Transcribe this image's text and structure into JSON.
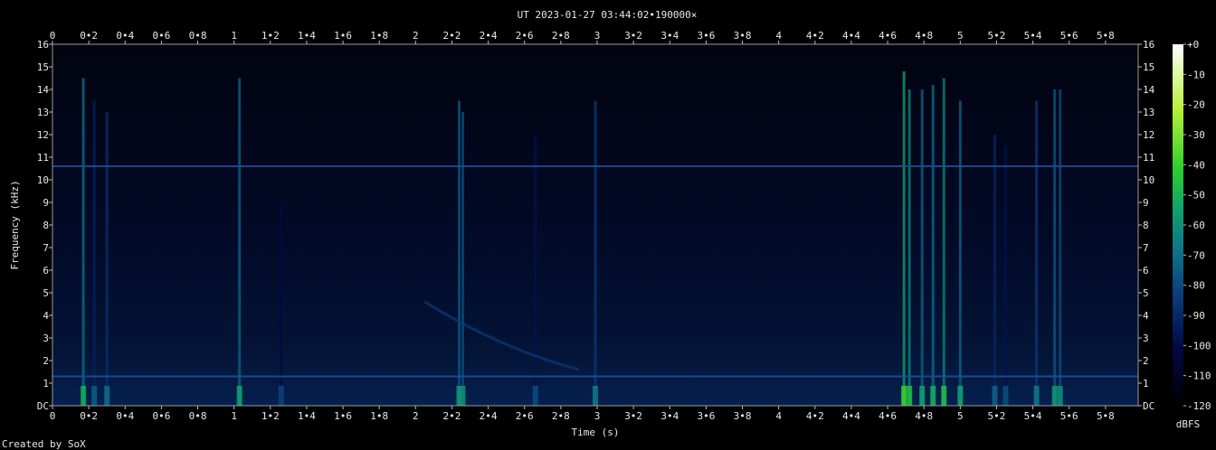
{
  "chart_data": {
    "type": "heatmap",
    "title": "UT 2023-01-27 03:44:02•190000×",
    "xlabel": "Time (s)",
    "ylabel": "Frequency (kHz)",
    "xlim": [
      0,
      5.98
    ],
    "ylim": [
      0,
      16
    ],
    "x_ticks": [
      "0",
      "0•2",
      "0•4",
      "0•6",
      "0•8",
      "1",
      "1•2",
      "1•4",
      "1•6",
      "1•8",
      "2",
      "2•2",
      "2•4",
      "2•6",
      "2•8",
      "3",
      "3•2",
      "3•4",
      "3•6",
      "3•8",
      "4",
      "4•2",
      "4•4",
      "4•6",
      "4•8",
      "5",
      "5•2",
      "5•4",
      "5•6",
      "5•8"
    ],
    "y_ticks": [
      "DC",
      "1",
      "2",
      "3",
      "4",
      "5",
      "6",
      "7",
      "8",
      "9",
      "10",
      "11",
      "12",
      "13",
      "14",
      "15",
      "16"
    ],
    "colorbar": {
      "unit": "dBFS",
      "range": [
        -120,
        0
      ],
      "ticks": [
        "+0",
        "-10",
        "-20",
        "-30",
        "-40",
        "-50",
        "-60",
        "-70",
        "-80",
        "-90",
        "-100",
        "-110",
        "-120"
      ],
      "colors": [
        "#000000",
        "#020845",
        "#0b3a7a",
        "#0e6f8a",
        "#11a56a",
        "#2fd02c",
        "#b6ef3c",
        "#ffffff"
      ]
    },
    "background_colors": [
      "#01030f",
      "#041a46"
    ],
    "steady_tones_khz": [
      10.6,
      1.3
    ],
    "impulse_events": [
      {
        "t": 0.17,
        "fmax": 14.5,
        "level": -80
      },
      {
        "t": 0.23,
        "fmax": 13.5,
        "level": -95
      },
      {
        "t": 0.3,
        "fmax": 13.0,
        "level": -92
      },
      {
        "t": 1.03,
        "fmax": 14.5,
        "level": -82
      },
      {
        "t": 1.26,
        "fmax": 9.0,
        "level": -100
      },
      {
        "t": 2.24,
        "fmax": 13.5,
        "level": -84
      },
      {
        "t": 2.26,
        "fmax": 13.0,
        "level": -86
      },
      {
        "t": 2.66,
        "fmax": 12.0,
        "level": -98
      },
      {
        "t": 2.99,
        "fmax": 13.5,
        "level": -90
      },
      {
        "t": 4.69,
        "fmax": 14.8,
        "level": -70
      },
      {
        "t": 4.72,
        "fmax": 14.0,
        "level": -76
      },
      {
        "t": 4.79,
        "fmax": 14.0,
        "level": -82
      },
      {
        "t": 4.85,
        "fmax": 14.2,
        "level": -80
      },
      {
        "t": 4.91,
        "fmax": 14.5,
        "level": -76
      },
      {
        "t": 5.0,
        "fmax": 13.5,
        "level": -82
      },
      {
        "t": 5.19,
        "fmax": 12.0,
        "level": -94
      },
      {
        "t": 5.25,
        "fmax": 11.5,
        "level": -98
      },
      {
        "t": 5.42,
        "fmax": 13.5,
        "level": -90
      },
      {
        "t": 5.52,
        "fmax": 14.0,
        "level": -84
      },
      {
        "t": 5.55,
        "fmax": 14.0,
        "level": -86
      }
    ],
    "sweep": {
      "t_start": 2.05,
      "t_end": 2.9,
      "f_start": 4.6,
      "f_end": 1.6
    }
  },
  "credit": "Created by SoX"
}
